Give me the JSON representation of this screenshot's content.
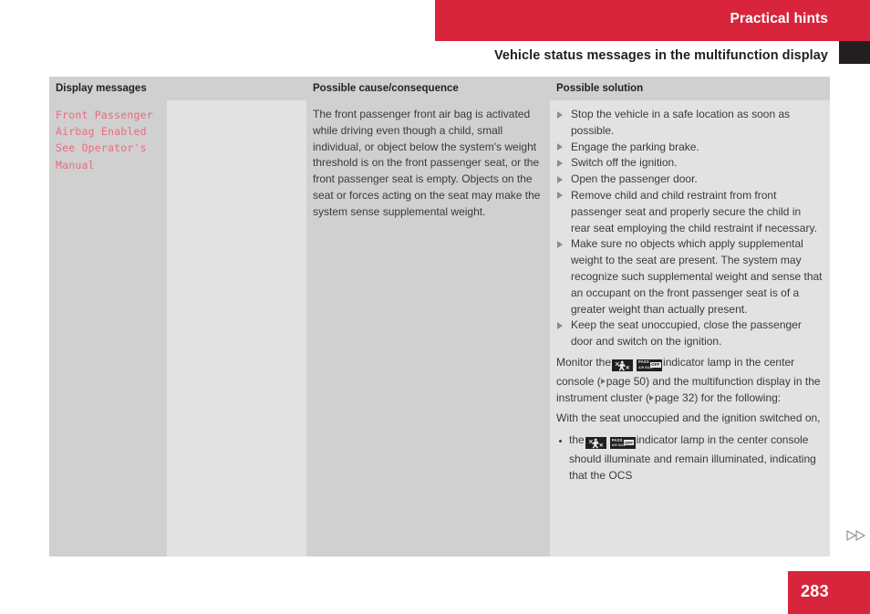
{
  "header": {
    "chapter_title": "Practical hints",
    "section_title": "Vehicle status messages in the multifunction display",
    "accent_color": "#d8253c",
    "tab_color": "#231f20"
  },
  "table": {
    "columns": [
      {
        "header": "Display messages"
      },
      {
        "header": "Possible cause/consequence"
      },
      {
        "header": "Possible solution"
      }
    ],
    "row": {
      "display_message": "Front Passenger\nAirbag Enabled\nSee Operator's\nManual",
      "display_message_color": "#f0697e",
      "cause": "The front passenger front air bag is activated while driving even though a child, small individual, or object below the system's weight threshold is on the front passenger seat, or the front passenger seat is empty. Objects on the seat or forces acting on the seat may make the system sense supplemental weight.",
      "solution_bullets": [
        "Stop the vehicle in a safe location as soon as possible.",
        "Engage the parking brake.",
        "Switch off the ignition.",
        "Open the passenger door.",
        "Remove child and child restraint from front passenger seat and properly secure the child in rear seat employing the child restraint if necessary.",
        "Make sure no objects which apply supplemental weight to the seat are present. The system may recognize such supplemental weight and sense that an occupant on the front passenger seat is of a greater weight than actually present.",
        "Keep the seat unoccupied, close the passenger door and switch on the ignition."
      ],
      "monitor_para": {
        "lead": "Monitor the",
        "mid": "indicator lamp in the center console (",
        "page_ref_1": "page 50",
        "after_ref_1": ") and the multifunction display in the instrument cluster (",
        "page_ref_2": "page 32",
        "after_ref_2": ") for the following:"
      },
      "with_seat_para": "With the seat unoccupied and the ignition switched on,",
      "sub_bullet": {
        "lead": "the",
        "rest": "indicator lamp in the center console should illuminate and remain illuminated, indicating that the OCS"
      }
    }
  },
  "icons": {
    "lamp_person": "passenger-airbag-person-icon",
    "lamp_pass_airbag": "pass-air-bag-off-icon",
    "ref_arrow": "reference-triangle-icon",
    "bullet_arrow": "bullet-triangle-icon",
    "continuation": "continuation-double-arrow-icon"
  },
  "footer": {
    "page_number": "283"
  }
}
